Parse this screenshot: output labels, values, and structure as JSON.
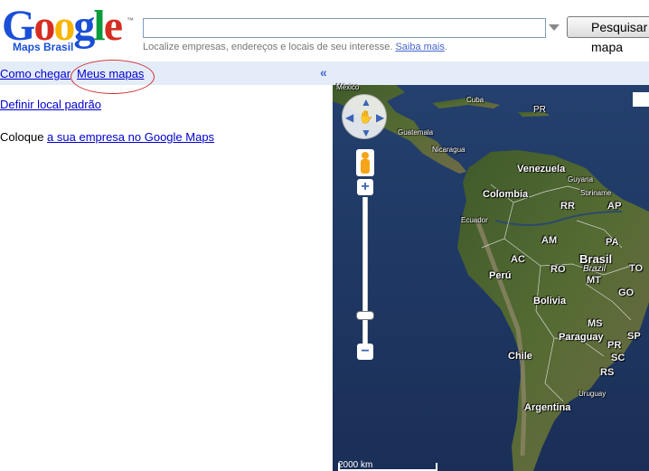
{
  "header": {
    "logo_letters": [
      {
        "ch": "G",
        "color": "#1a4fd6"
      },
      {
        "ch": "o",
        "color": "#d62d20"
      },
      {
        "ch": "o",
        "color": "#f7b500"
      },
      {
        "ch": "g",
        "color": "#1a4fd6"
      },
      {
        "ch": "l",
        "color": "#0a9b3c"
      },
      {
        "ch": "e",
        "color": "#d62d20"
      }
    ],
    "logo_tm": "™",
    "logo_subtitle": "Maps Brasil",
    "search_value": "",
    "search_button": "Pesquisar no mapa",
    "hint_text": "Localize empresas, endereços e locais de seu interesse. ",
    "hint_link": "Saiba mais",
    "hint_end": "."
  },
  "sidebar": {
    "tab_directions": "Como chegar",
    "tab_my_maps": "Meus mapas",
    "collapse": "«",
    "default_location": "Definir local padrão",
    "business_prefix": "Coloque ",
    "business_link": "a sua empresa no Google Maps"
  },
  "map": {
    "countries": {
      "mexico": "México",
      "cuba": "Cuba",
      "pr": "PR",
      "guatemala": "Guatemala",
      "nicaragua": "Nicaragua",
      "venezuela": "Venezuela",
      "guyana": "Guyana",
      "suriname": "Suriname",
      "colombia": "Colombia",
      "ecuador": "Ecuador",
      "peru": "Perú",
      "brasil": "Brasil",
      "brasil_it": "Brazil",
      "bolivia": "Bolivia",
      "paraguay": "Paraguay",
      "chile": "Chile",
      "argentina": "Argentina",
      "uruguay": "Uruguay"
    },
    "states": {
      "rr": "RR",
      "ap": "AP",
      "am": "AM",
      "pa": "PA",
      "ac": "AC",
      "ro": "RO",
      "mt": "MT",
      "to": "TO",
      "go": "GO",
      "ms": "MS",
      "sp": "SP",
      "pr": "PR",
      "sc": "SC",
      "rs": "RS"
    },
    "scale_label": "2000 km"
  },
  "colors": {
    "link": "#0000cc",
    "tabbar": "#e5ecf9",
    "ocean": "#1d3560",
    "highlight_oval": "#cc3333"
  }
}
